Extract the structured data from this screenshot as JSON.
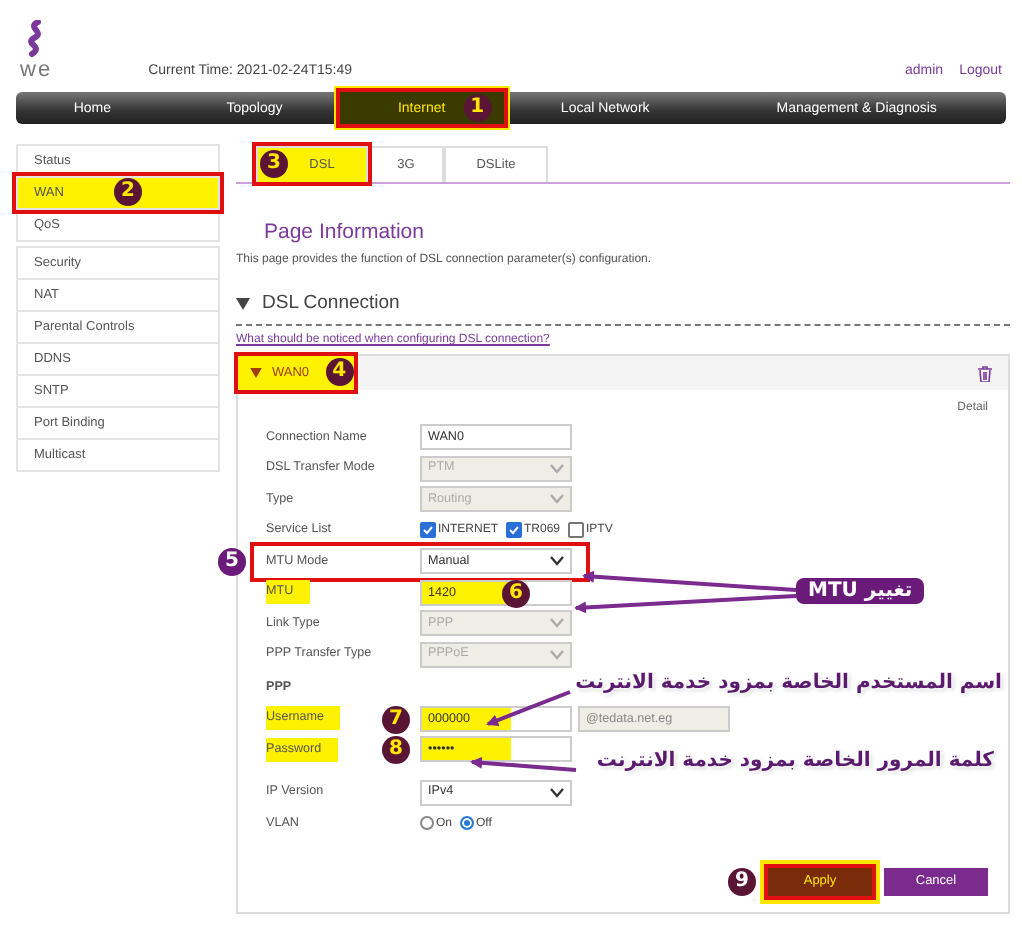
{
  "header": {
    "logo_text": "we",
    "time_label": "Current Time: 2021-02-24T15:49",
    "user": "admin",
    "logout": "Logout"
  },
  "nav": [
    {
      "label": "Home",
      "selected": false
    },
    {
      "label": "Topology",
      "selected": false
    },
    {
      "label": "Internet",
      "selected": true,
      "step": "1",
      "boxed": true
    },
    {
      "label": "Local Network",
      "selected": false
    },
    {
      "label": "Management & Diagnosis",
      "selected": false
    }
  ],
  "sidebar": [
    {
      "label": "Status",
      "selected": false
    },
    {
      "label": "WAN",
      "selected": true,
      "step": "2",
      "boxed": true
    },
    {
      "label": "QoS",
      "selected": false
    },
    {
      "label": "Security",
      "selected": false
    },
    {
      "label": "NAT",
      "selected": false
    },
    {
      "label": "Parental Controls",
      "selected": false
    },
    {
      "label": "DDNS",
      "selected": false
    },
    {
      "label": "SNTP",
      "selected": false
    },
    {
      "label": "Port Binding",
      "selected": false
    },
    {
      "label": "Multicast",
      "selected": false
    }
  ],
  "tabs": [
    {
      "label": "DSL",
      "selected": true,
      "step": "3",
      "boxed": true
    },
    {
      "label": "3G",
      "selected": false
    },
    {
      "label": "DSLite",
      "selected": false
    }
  ],
  "page_title": "Page Information",
  "page_description": "This page provides the function of DSL connection parameter(s) configuration.",
  "section": {
    "title": "DSL Connection",
    "expanded": true
  },
  "help_link": "What should be noticed when configuring DSL connection?",
  "connection": {
    "name": "WAN0",
    "expanded": true,
    "step": "4",
    "boxed": true,
    "detail": "Detail",
    "rows": [
      {
        "kind": "text",
        "label": "Connection Name",
        "value": "WAN0"
      },
      {
        "kind": "select",
        "label": "DSL Transfer Mode",
        "value": "PTM",
        "disabled": true
      },
      {
        "kind": "select",
        "label": "Type",
        "value": "Routing",
        "disabled": true
      },
      {
        "kind": "checks",
        "label": "Service List",
        "options": [
          {
            "label": "INTERNET",
            "checked": true
          },
          {
            "label": "TR069",
            "checked": true
          },
          {
            "label": "IPTV",
            "checked": false
          }
        ]
      },
      {
        "kind": "select",
        "label": "MTU Mode",
        "value": "Manual",
        "disabled": false,
        "step": "5",
        "boxed": true
      },
      {
        "kind": "text",
        "label": "MTU",
        "value": "1420",
        "highlighted": true,
        "step": "6"
      },
      {
        "kind": "select",
        "label": "Link Type",
        "value": "PPP",
        "disabled": true
      },
      {
        "kind": "select",
        "label": "PPP Transfer Type",
        "value": "PPPoE",
        "disabled": true
      },
      {
        "kind": "heading",
        "label": "PPP"
      },
      {
        "kind": "text",
        "label": "Username",
        "value": "000000",
        "suffix": "@tedata.net.eg",
        "highlighted": true,
        "step": "7"
      },
      {
        "kind": "text",
        "label": "Password",
        "value": "••••••",
        "highlighted": true,
        "step": "8"
      },
      {
        "kind": "select",
        "label": "IP Version",
        "value": "IPv4",
        "disabled": false
      },
      {
        "kind": "radios",
        "label": "VLAN",
        "options": [
          {
            "label": "On",
            "selected": false
          },
          {
            "label": "Off",
            "selected": true
          }
        ]
      }
    ]
  },
  "buttons": [
    {
      "label": "Apply",
      "kind": "primary",
      "step": "9",
      "boxed": true
    },
    {
      "label": "Cancel",
      "kind": "secondary"
    }
  ],
  "callouts": [
    {
      "text": "تغيير MTU",
      "kind": "pill"
    },
    {
      "text": "اسم المستخدم الخاصة بمزود خدمة الانترنت",
      "kind": "outlined"
    },
    {
      "text": "كلمة المرور الخاصة بمزود خدمة الانترنت",
      "kind": "outlined"
    }
  ]
}
